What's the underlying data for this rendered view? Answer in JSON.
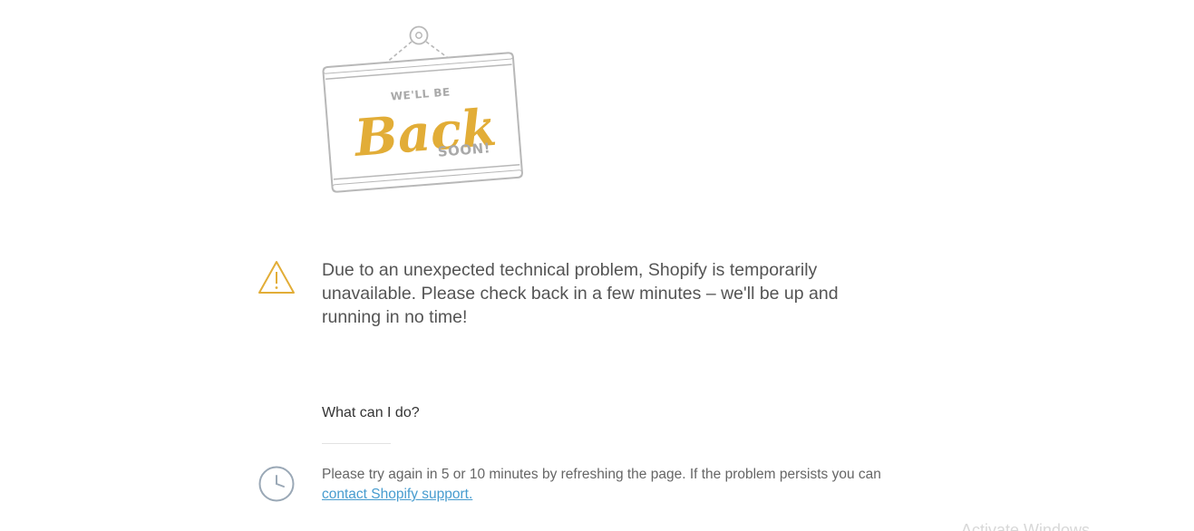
{
  "sign": {
    "line1": "WE'LL BE",
    "line2": "Back",
    "line3": "SOON!"
  },
  "notice": {
    "icon": "warning-icon",
    "text": "Due to an unexpected technical problem, Shopify is temporarily unavailable. Please check back in a few minutes – we'll be up and running in no time!"
  },
  "help": {
    "heading": "What can I do?",
    "icon": "clock-icon",
    "text_before_link": "Please try again in 5 or 10 minutes by refreshing the page. If the problem persists you can ",
    "link_text": "contact Shopify support."
  },
  "watermark": {
    "text": "Activate Windows"
  },
  "colors": {
    "accent": "#e2ad37",
    "sign_frame": "#b8b8b8",
    "sign_text": "#a9a9a9",
    "clock": "#9aa8b6",
    "link": "#479ccf",
    "body_text": "#545454"
  }
}
